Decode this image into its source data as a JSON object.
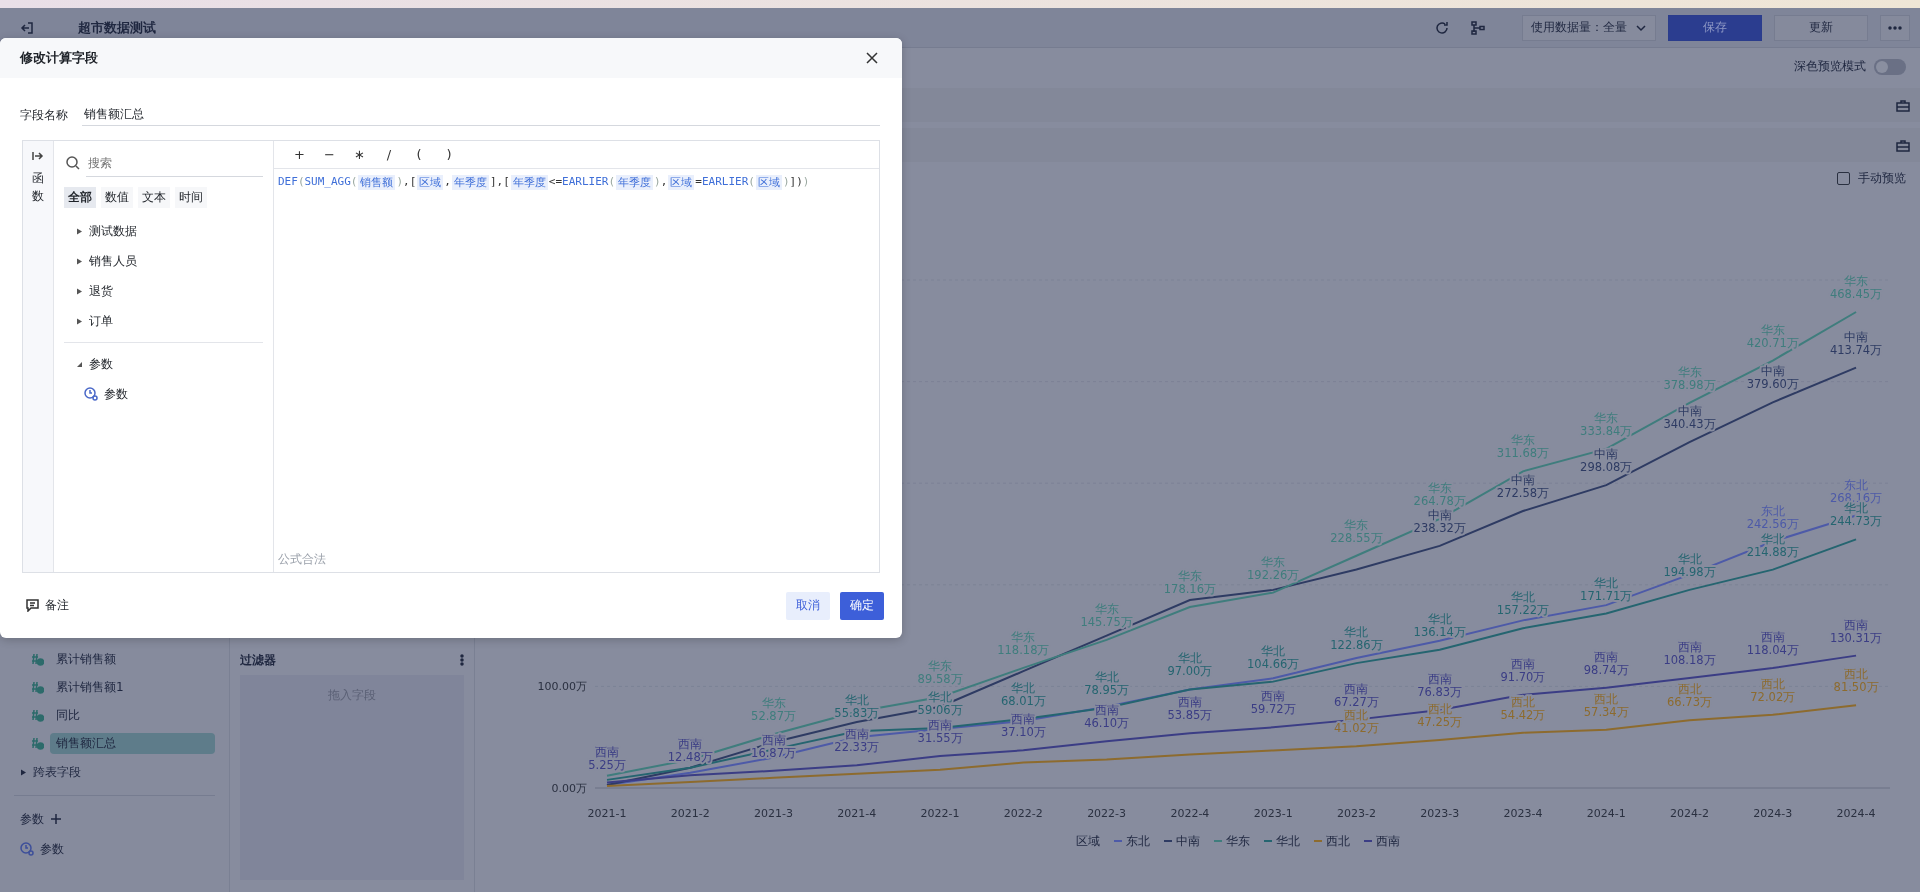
{
  "header": {
    "title": "超市数据测试",
    "data_amount": "使用数据量：全量",
    "buttons": [
      {
        "label": "保存",
        "kind": "primary"
      },
      {
        "label": "更新",
        "kind": "default"
      }
    ]
  },
  "preview": {
    "dark_mode_label": "深色预览模式",
    "dark_mode_on": false,
    "manual_label": "手动预览",
    "manual_checked": false
  },
  "sidebar": {
    "fields": [
      {
        "label": "累计销售额",
        "selected": false
      },
      {
        "label": "累计销售额1",
        "selected": false
      },
      {
        "label": "同比",
        "selected": false
      },
      {
        "label": "销售额汇总",
        "selected": true
      }
    ],
    "cross_table": {
      "label": "跨表字段",
      "expanded": false
    },
    "params_title": "参数",
    "params": [
      {
        "label": "参数"
      }
    ]
  },
  "filter": {
    "title": "过滤器",
    "placeholder": "拖入字段"
  },
  "chart": {
    "legend_title": "区域",
    "chart_data": {
      "type": "line",
      "categories": [
        "2021-1",
        "2021-2",
        "2021-3",
        "2021-4",
        "2022-1",
        "2022-2",
        "2022-3",
        "2022-4",
        "2023-1",
        "2023-2",
        "2023-3",
        "2023-4",
        "2024-1",
        "2024-2",
        "2024-3",
        "2024-4"
      ],
      "ylim": [
        0,
        500
      ],
      "yticks": [
        {
          "value": 0,
          "label": "0.00万"
        },
        {
          "value": 100,
          "label": "100.00万"
        }
      ],
      "series": [
        {
          "name": "东北",
          "color": "#4d5aa8",
          "values": [
            3,
            15,
            30,
            50,
            58,
            66,
            80,
            97,
            108,
            128,
            145,
            165,
            180,
            210,
            242.6,
            268.2
          ]
        },
        {
          "name": "中南",
          "color": "#2e3b63",
          "values": [
            3,
            20,
            45,
            65,
            80,
            115,
            150,
            185,
            195,
            215,
            238.3,
            272.6,
            298.1,
            340.4,
            379.6,
            413.7
          ]
        },
        {
          "name": "华东",
          "color": "#3f7d7d",
          "values": [
            12,
            28,
            52.9,
            75,
            89.6,
            118.2,
            145.8,
            178.2,
            192.3,
            228.6,
            264.8,
            311.7,
            333.8,
            379,
            420.7,
            468.5
          ]
        },
        {
          "name": "华北",
          "color": "#256570",
          "values": [
            8,
            20,
            38,
            55.8,
            59.1,
            68,
            79,
            97,
            104.7,
            122.9,
            136.1,
            157.2,
            171.7,
            195,
            214.9,
            244.7
          ]
        },
        {
          "name": "西北",
          "color": "#8d6b2e",
          "values": [
            2,
            6,
            10,
            14,
            18,
            25,
            28,
            33,
            37,
            41,
            47.3,
            54.4,
            57.3,
            66.7,
            72,
            81.5
          ]
        },
        {
          "name": "西南",
          "color": "#3b3d85",
          "values": [
            5.3,
            12.5,
            16.9,
            22.3,
            31.6,
            37.1,
            46.1,
            53.9,
            59.7,
            67.3,
            76.8,
            91.7,
            98.7,
            108.2,
            118,
            130.3
          ]
        }
      ],
      "value_labels": [
        [
          null,
          null,
          null,
          null,
          null,
          null,
          null,
          null,
          null,
          null,
          null,
          null,
          null,
          null,
          "242.56万",
          "268.16万"
        ],
        [
          null,
          null,
          null,
          null,
          null,
          null,
          null,
          null,
          null,
          null,
          "238.32万",
          "272.58万",
          "298.08万",
          "340.43万",
          "379.60万",
          "413.74万"
        ],
        [
          null,
          null,
          "52.87万",
          null,
          "89.58万",
          "118.18万",
          "145.75万",
          "178.16万",
          "192.26万",
          "228.55万",
          "264.78万",
          "311.68万",
          "333.84万",
          "378.98万",
          "420.71万",
          "468.45万"
        ],
        [
          null,
          null,
          null,
          "55.83万",
          "59.06万",
          "68.01万",
          "78.95万",
          "97.00万",
          "104.66万",
          "122.86万",
          "136.14万",
          "157.22万",
          "171.71万",
          "194.98万",
          "214.88万",
          "244.73万"
        ],
        [
          null,
          null,
          null,
          null,
          null,
          null,
          null,
          null,
          null,
          "41.02万",
          "47.25万",
          "54.42万",
          "57.34万",
          "66.73万",
          "72.02万",
          "81.50万"
        ],
        [
          "5.25万",
          "12.48万",
          "16.87万",
          "22.33万",
          "31.55万",
          "37.10万",
          "46.10万",
          "53.85万",
          "59.72万",
          "67.27万",
          "76.83万",
          "91.70万",
          "98.74万",
          "108.18万",
          "118.04万",
          "130.31万"
        ]
      ]
    }
  },
  "dialog": {
    "title": "修改计算字段",
    "name_label": "字段名称",
    "name_value": "销售额汇总",
    "rail_label": "函数",
    "search_placeholder": "搜索",
    "tabs": [
      {
        "label": "全部",
        "selected": true
      },
      {
        "label": "数值",
        "selected": false
      },
      {
        "label": "文本",
        "selected": false
      },
      {
        "label": "时间",
        "selected": false
      }
    ],
    "tree": [
      {
        "label": "测试数据",
        "expanded": false
      },
      {
        "label": "销售人员",
        "expanded": false
      },
      {
        "label": "退货",
        "expanded": false
      },
      {
        "label": "订单",
        "expanded": false
      }
    ],
    "param_group": {
      "label": "参数",
      "expanded": true,
      "children": [
        {
          "label": "参数"
        }
      ]
    },
    "operators": [
      "+",
      "−",
      "∗",
      "/",
      "(",
      ")"
    ],
    "formula": [
      {
        "kind": "func",
        "text": "DEF"
      },
      {
        "kind": "paren",
        "text": "("
      },
      {
        "kind": "func",
        "text": "SUM_AGG"
      },
      {
        "kind": "paren",
        "text": "("
      },
      {
        "kind": "field",
        "text": "销售额"
      },
      {
        "kind": "paren",
        "text": ")"
      },
      {
        "kind": "punct",
        "text": ",["
      },
      {
        "kind": "field",
        "text": "区域"
      },
      {
        "kind": "punct",
        "text": ","
      },
      {
        "kind": "field",
        "text": "年季度"
      },
      {
        "kind": "punct",
        "text": "],["
      },
      {
        "kind": "field",
        "text": "年季度"
      },
      {
        "kind": "punct",
        "text": "<="
      },
      {
        "kind": "func",
        "text": "EARLIER"
      },
      {
        "kind": "paren",
        "text": "("
      },
      {
        "kind": "field",
        "text": "年季度"
      },
      {
        "kind": "paren",
        "text": ")"
      },
      {
        "kind": "punct",
        "text": ","
      },
      {
        "kind": "field",
        "text": "区域"
      },
      {
        "kind": "punct",
        "text": "="
      },
      {
        "kind": "func",
        "text": "EARLIER"
      },
      {
        "kind": "paren",
        "text": "("
      },
      {
        "kind": "field",
        "text": "区域"
      },
      {
        "kind": "paren",
        "text": ")"
      },
      {
        "kind": "punct",
        "text": "])"
      },
      {
        "kind": "paren",
        "text": ")"
      }
    ],
    "status": "公式合法",
    "note": "备注",
    "buttons": [
      {
        "label": "取消",
        "kind": "secondary"
      },
      {
        "label": "确定",
        "kind": "primary"
      }
    ]
  }
}
